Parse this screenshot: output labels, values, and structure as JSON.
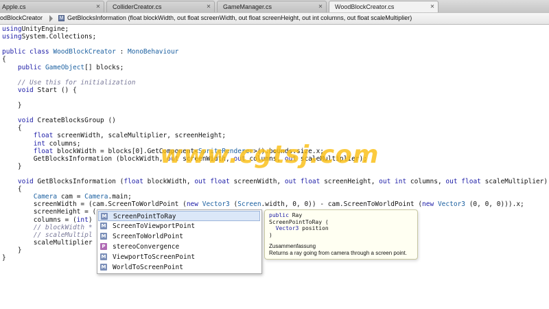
{
  "tabs": [
    {
      "label": "Apple.cs",
      "active": false
    },
    {
      "label": "ColliderCreator.cs",
      "active": false
    },
    {
      "label": "GameManager.cs",
      "active": false
    },
    {
      "label": "WoodBlockCreator.cs",
      "active": true
    }
  ],
  "pathbar": {
    "file": "odBlockCreator",
    "member_icon": "M",
    "member": "GetBlocksInformation (float blockWidth, out float screenWidth, out float screenHeight, out int columns, out float scaleMultiplier)"
  },
  "code": [
    [
      [
        "kw",
        "using"
      ],
      [
        "",
        "UnityEngine;"
      ]
    ],
    [
      [
        "kw",
        "using"
      ],
      [
        "",
        "System.Collections;"
      ]
    ],
    [],
    [
      [
        "kw",
        "public class"
      ],
      [
        "ty",
        " WoodBlockCreator"
      ],
      [
        "",
        " : "
      ],
      [
        "ty",
        "MonoBehaviour"
      ]
    ],
    [
      [
        "",
        "{"
      ]
    ],
    [
      [
        "",
        "    "
      ],
      [
        "kw",
        "public"
      ],
      [
        "ty",
        " GameObject"
      ],
      [
        "",
        "[] blocks;"
      ]
    ],
    [],
    [
      [
        "",
        "    "
      ],
      [
        "cm",
        "// Use this for initialization"
      ]
    ],
    [
      [
        "",
        "    "
      ],
      [
        "kw",
        "void"
      ],
      [
        "",
        " Start () {"
      ]
    ],
    [],
    [
      [
        "",
        "    }"
      ]
    ],
    [],
    [
      [
        "",
        "    "
      ],
      [
        "kw",
        "void"
      ],
      [
        "",
        " CreateBlocksGroup ()"
      ]
    ],
    [
      [
        "",
        "    {"
      ]
    ],
    [
      [
        "",
        "        "
      ],
      [
        "kw",
        "float"
      ],
      [
        "",
        " screenWidth, scaleMultiplier, screenHeight;"
      ]
    ],
    [
      [
        "",
        "        "
      ],
      [
        "kw",
        "int"
      ],
      [
        "",
        " columns;"
      ]
    ],
    [
      [
        "",
        "        "
      ],
      [
        "kw",
        "float"
      ],
      [
        "",
        " blockWidth = blocks[0].GetComponent<"
      ],
      [
        "ty",
        "SpriteRenderer"
      ],
      [
        "",
        ">().bounds.size.x;"
      ]
    ],
    [
      [
        "",
        "        GetBlocksInformation (blockWidth, "
      ],
      [
        "kw",
        "out"
      ],
      [
        "",
        " screenWidth, "
      ],
      [
        "kw",
        "out"
      ],
      [
        "",
        " columns, "
      ],
      [
        "kw",
        "out"
      ],
      [
        "",
        " scaleMultiplier);"
      ]
    ],
    [
      [
        "",
        "    }"
      ]
    ],
    [],
    [
      [
        "",
        "    "
      ],
      [
        "kw",
        "void"
      ],
      [
        "",
        " GetBlocksInformation ("
      ],
      [
        "kw",
        "float"
      ],
      [
        "",
        " blockWidth, "
      ],
      [
        "kw",
        "out float"
      ],
      [
        "",
        " screenWidth, "
      ],
      [
        "kw",
        "out float"
      ],
      [
        "",
        " screenHeight, "
      ],
      [
        "kw",
        "out int"
      ],
      [
        "",
        " columns, "
      ],
      [
        "kw",
        "out float"
      ],
      [
        "",
        " scaleMultiplier)"
      ]
    ],
    [
      [
        "",
        "    {"
      ]
    ],
    [
      [
        "",
        "        "
      ],
      [
        "ty",
        "Camera"
      ],
      [
        "",
        " cam = "
      ],
      [
        "ty",
        "Camera"
      ],
      [
        "",
        ".main;"
      ]
    ],
    [
      [
        "",
        "        screenWidth = (cam.ScreenToWorldPoint ("
      ],
      [
        "kw",
        "new"
      ],
      [
        "ty",
        " Vector3"
      ],
      [
        "",
        " ("
      ],
      [
        "ty",
        "Screen"
      ],
      [
        "",
        ".width, 0, 0)) - cam.ScreenToWorldPoint ("
      ],
      [
        "kw",
        "new"
      ],
      [
        "ty",
        " Vector3"
      ],
      [
        "",
        " (0, 0, 0))).x;"
      ]
    ],
    [
      [
        "",
        "        screenHeight = (cam.sc"
      ]
    ],
    [
      [
        "",
        "        columns = ("
      ],
      [
        "kw",
        "int"
      ],
      [
        "",
        ")"
      ]
    ],
    [
      [
        "",
        "        "
      ],
      [
        "cm",
        "// blockWidth *"
      ]
    ],
    [
      [
        "",
        "        "
      ],
      [
        "cm",
        "// scaleMultipl"
      ]
    ],
    [
      [
        "",
        "        scaleMultiplier"
      ]
    ],
    [
      [
        "",
        "    }"
      ]
    ],
    [
      [
        "",
        "}"
      ]
    ]
  ],
  "watermark": "www.cgtsj.com",
  "completion": {
    "items": [
      {
        "label": "ScreenPointToRay",
        "icon": "M",
        "kind": "method",
        "selected": true
      },
      {
        "label": "ScreenToViewportPoint",
        "icon": "M",
        "kind": "method",
        "selected": false
      },
      {
        "label": "ScreenToWorldPoint",
        "icon": "M",
        "kind": "method",
        "selected": false
      },
      {
        "label": "stereoConvergence",
        "icon": "P",
        "kind": "property",
        "selected": false
      },
      {
        "label": "ViewportToScreenPoint",
        "icon": "M",
        "kind": "method",
        "selected": false
      },
      {
        "label": "WorldToScreenPoint",
        "icon": "M",
        "kind": "method",
        "selected": false
      }
    ],
    "info": {
      "sig_line1_kw": "public",
      "sig_line1_type": " Ray",
      "sig_line2": "ScreenPointToRay (",
      "sig_line3_type": "  Vector3",
      "sig_line3_name": " position",
      "sig_line4": ")",
      "summary_title": "Zusammenfassung",
      "summary_text": "Returns a ray going from camera through a screen point."
    }
  },
  "colors": {
    "keyword": "#1a1aa6",
    "type": "#1a5fa0",
    "comment": "#7a7a9a",
    "selection": "#dbe7f8",
    "watermark": "#fabe14"
  }
}
